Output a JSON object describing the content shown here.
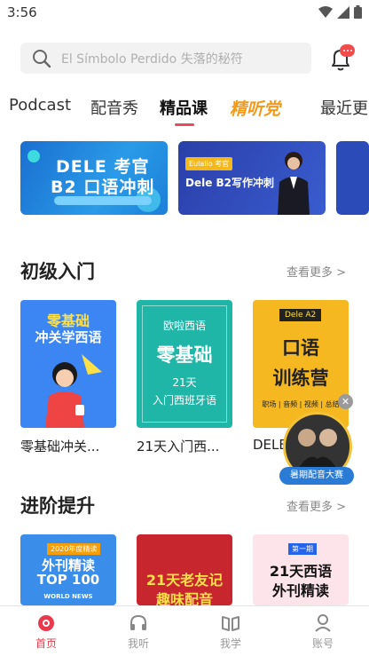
{
  "status_bar": {
    "time": "3:56"
  },
  "search": {
    "placeholder": "El Símbolo Perdido 失落的秘符"
  },
  "tabs": [
    {
      "label": "Podcast"
    },
    {
      "label": "配音秀"
    },
    {
      "label": "精品课",
      "active": true
    },
    {
      "label": "精听党"
    },
    {
      "label": "最近更"
    }
  ],
  "banners": [
    {
      "line1": "DELE 考官",
      "line2": "B2 口语冲刺"
    },
    {
      "tag": "Eulalio 考官",
      "title": "Dele B2写作冲刺"
    }
  ],
  "sections": [
    {
      "title": "初级入门",
      "see_more": "查看更多 >",
      "items": [
        {
          "label": "零基础冲关...",
          "cover": [
            "零基础",
            "冲关学西语"
          ]
        },
        {
          "label": "21天入门西...",
          "cover": [
            "欧啦西语",
            "零基础",
            "21天",
            "入门西班牙语"
          ]
        },
        {
          "label": "DELE",
          "cover": [
            "Dele A2",
            "口语",
            "训练营",
            "职场 | 音频 | 视频 | 总结"
          ]
        }
      ]
    },
    {
      "title": "进阶提升",
      "see_more": "查看更多 >",
      "items": [
        {
          "cover": [
            "2020年度精读",
            "外刊精读",
            "TOP 100",
            "WORLD NEWS"
          ]
        },
        {
          "cover": [
            "21天老友记",
            "趣味配音"
          ]
        },
        {
          "cover": [
            "第一期",
            "21天西语",
            "外刊精读"
          ]
        }
      ]
    }
  ],
  "promo": {
    "label": "暑期配音大赛",
    "close": "✕"
  },
  "bottom_nav": [
    {
      "label": "首页",
      "icon": "home-icon",
      "active": true
    },
    {
      "label": "我听",
      "icon": "headphones-icon"
    },
    {
      "label": "我学",
      "icon": "book-icon"
    },
    {
      "label": "账号",
      "icon": "person-icon"
    }
  ],
  "colors": {
    "accent": "#e83a4c",
    "orange": "#f39a1b"
  }
}
